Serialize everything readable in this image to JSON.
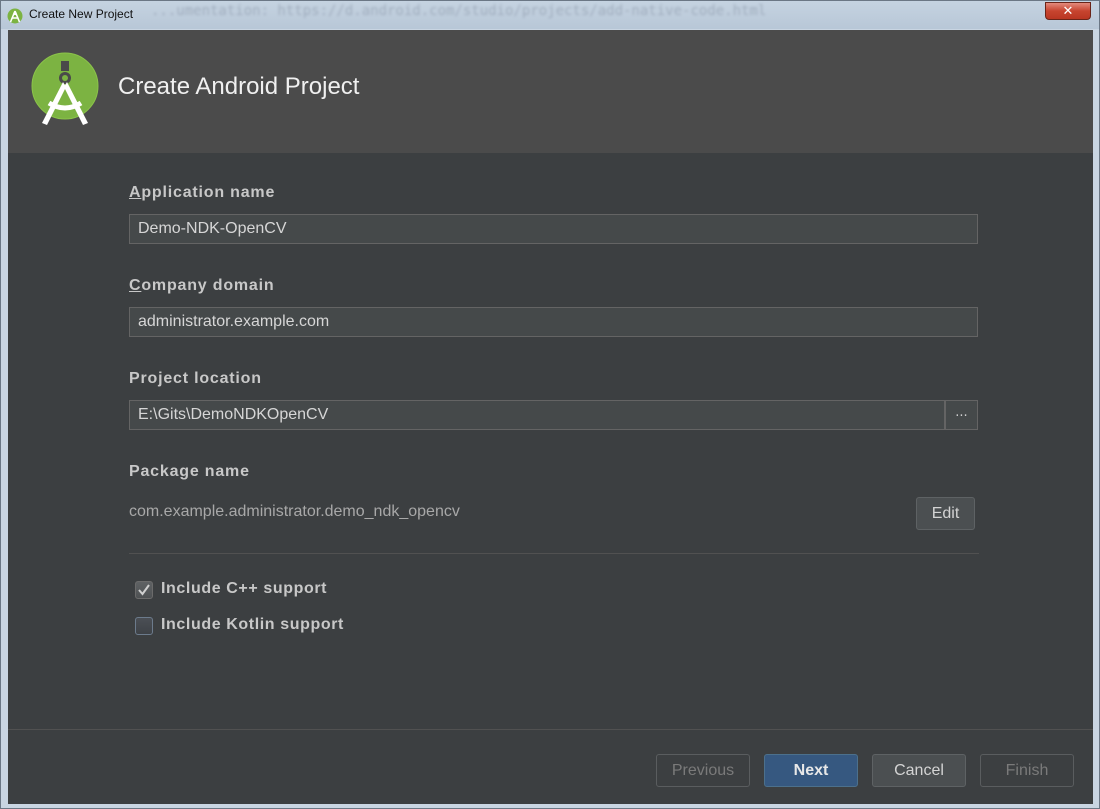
{
  "window": {
    "title": "Create New Project",
    "close_label": "✕",
    "background_text": "...umentation: https://d.android.com/studio/projects/add-native-code.html"
  },
  "banner": {
    "heading": "Create Android Project",
    "logo_icon": "android-studio-icon",
    "logo_color": "#7cb342"
  },
  "form": {
    "app_name": {
      "label_mnemonic": "A",
      "label_rest": "pplication name",
      "value": "Demo-NDK-OpenCV"
    },
    "company_domain": {
      "label_mnemonic": "C",
      "label_rest": "ompany domain",
      "value": "administrator.example.com"
    },
    "project_location": {
      "label": "Project location",
      "value": "E:\\Gits\\DemoNDKOpenCV",
      "browse_label": "..."
    },
    "package_name": {
      "label": "Package name",
      "value": "com.example.administrator.demo_ndk_opencv",
      "edit_label": "Edit"
    }
  },
  "options": {
    "cpp": {
      "label": "Include C++ support",
      "checked": true
    },
    "kotlin": {
      "label": "Include Kotlin support",
      "checked": false
    }
  },
  "footer": {
    "previous_label": "Previous",
    "next_label": "Next",
    "cancel_label": "Cancel",
    "finish_label": "Finish"
  },
  "colors": {
    "dialog_bg": "#3c3f41",
    "banner_bg": "#4b4b4b",
    "primary_button": "#365880"
  }
}
